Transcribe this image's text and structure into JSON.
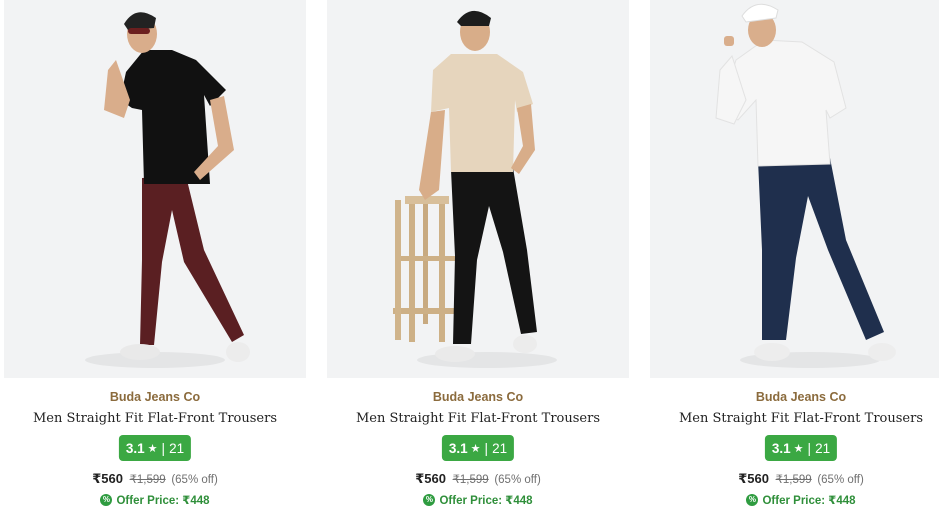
{
  "products": [
    {
      "brand": "Buda Jeans Co",
      "name": "Men Straight Fit Flat-Front Trousers",
      "rating": "3.1",
      "rating_count": "21",
      "price": "₹560",
      "mrp": "₹1,599",
      "discount": "(65% off)",
      "offer_price": "Offer Price: ₹448",
      "tshirt_color": "#111111",
      "trouser_color": "#5a1f22"
    },
    {
      "brand": "Buda Jeans Co",
      "name": "Men Straight Fit Flat-Front Trousers",
      "rating": "3.1",
      "rating_count": "21",
      "price": "₹560",
      "mrp": "₹1,599",
      "discount": "(65% off)",
      "offer_price": "Offer Price: ₹448",
      "tshirt_color": "#e6d5bd",
      "trouser_color": "#141414"
    },
    {
      "brand": "Buda Jeans Co",
      "name": "Men Straight Fit Flat-Front Trousers",
      "rating": "3.1",
      "rating_count": "21",
      "price": "₹560",
      "mrp": "₹1,599",
      "discount": "(65% off)",
      "offer_price": "Offer Price: ₹448",
      "tshirt_color": "#f6f6f6",
      "trouser_color": "#1f2f4d"
    }
  ],
  "colors": {
    "brand_text": "#8b6b3d",
    "rating_bg": "#3ba843",
    "offer_text": "#2f8f3a"
  },
  "icons": {
    "rating": "star-icon",
    "offer": "offer-badge-icon"
  }
}
